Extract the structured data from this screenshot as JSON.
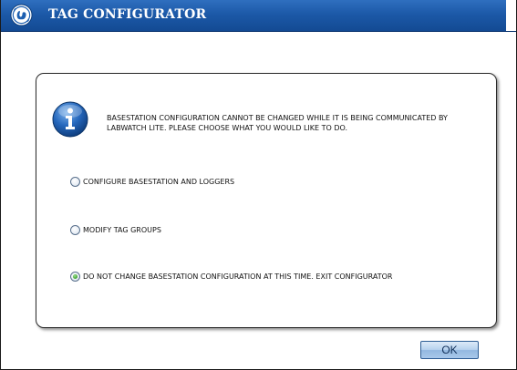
{
  "window": {
    "title": "TAG CONFIGURATOR"
  },
  "dialog": {
    "message": "BASESTATION CONFIGURATION CANNOT BE CHANGED WHILE IT IS BEING COMMUNICATED BY LABWATCH LITE. PLEASE CHOOSE WHAT YOU WOULD LIKE TO DO.",
    "icon": "info-icon",
    "options": [
      {
        "label": "CONFIGURE BASESTATION AND LOGGERS",
        "selected": false
      },
      {
        "label": "MODIFY TAG GROUPS",
        "selected": false
      },
      {
        "label": "DO NOT CHANGE BASESTATION CONFIGURATION AT THIS TIME. EXIT CONFIGURATOR",
        "selected": true
      }
    ],
    "ok_label": "OK"
  },
  "colors": {
    "titlebar": "#1c59a8",
    "title_text": "#ffffff",
    "radio_selected": "#3aa12e",
    "info_icon": "#1d5fb0"
  }
}
